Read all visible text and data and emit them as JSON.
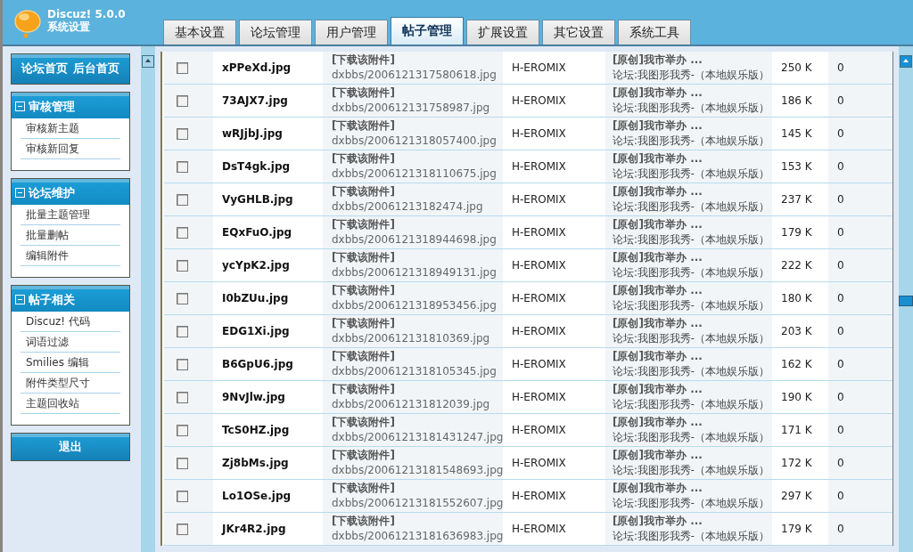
{
  "header": {
    "product": "Discuz! 5.0.0",
    "subtitle": "系统设置"
  },
  "tabs": [
    {
      "label": "基本设置",
      "selected": false
    },
    {
      "label": "论坛管理",
      "selected": false
    },
    {
      "label": "用户管理",
      "selected": false
    },
    {
      "label": "帖子管理",
      "selected": true
    },
    {
      "label": "扩展设置",
      "selected": false
    },
    {
      "label": "其它设置",
      "selected": false
    },
    {
      "label": "系统工具",
      "selected": false
    }
  ],
  "sidebar": {
    "home_links": [
      "论坛首页",
      "后台首页"
    ],
    "groups": [
      {
        "title": "审核管理",
        "expanded": true,
        "items": [
          "审核新主题",
          "审核新回复"
        ]
      },
      {
        "title": "论坛维护",
        "expanded": true,
        "items": [
          "批量主题管理",
          "批量删帖",
          "编辑附件"
        ]
      },
      {
        "title": "帖子相关",
        "expanded": true,
        "items": [
          "Discuz! 代码",
          "词语过滤",
          "Smilies 编辑",
          "附件类型尺寸",
          "主题回收站"
        ]
      }
    ],
    "logout": "退出"
  },
  "table": {
    "rows": [
      {
        "checked": false,
        "filename": "xPPeXd.jpg",
        "link": "[下载该附件]",
        "path": "dxbbs/2006121317580618.jpg",
        "uploader": "H-EROMIX",
        "title": "[原创]我市举办 ...",
        "forum": "论坛:我图形我秀-（本地娱乐版）",
        "size": "250 K",
        "downloads": "0"
      },
      {
        "checked": false,
        "filename": "73AJX7.jpg",
        "link": "[下载该附件]",
        "path": "dxbbs/200612131758987.jpg",
        "uploader": "H-EROMIX",
        "title": "[原创]我市举办 ...",
        "forum": "论坛:我图形我秀-（本地娱乐版）",
        "size": "186 K",
        "downloads": "0"
      },
      {
        "checked": false,
        "filename": "wRJjbJ.jpg",
        "link": "[下载该附件]",
        "path": "dxbbs/2006121318057400.jpg",
        "uploader": "H-EROMIX",
        "title": "[原创]我市举办 ...",
        "forum": "论坛:我图形我秀-（本地娱乐版）",
        "size": "145 K",
        "downloads": "0"
      },
      {
        "checked": false,
        "filename": "DsT4gk.jpg",
        "link": "[下载该附件]",
        "path": "dxbbs/2006121318110675.jpg",
        "uploader": "H-EROMIX",
        "title": "[原创]我市举办 ...",
        "forum": "论坛:我图形我秀-（本地娱乐版）",
        "size": "153 K",
        "downloads": "0"
      },
      {
        "checked": false,
        "filename": "VyGHLB.jpg",
        "link": "[下载该附件]",
        "path": "dxbbs/20061213182474.jpg",
        "uploader": "H-EROMIX",
        "title": "[原创]我市举办 ...",
        "forum": "论坛:我图形我秀-（本地娱乐版）",
        "size": "237 K",
        "downloads": "0"
      },
      {
        "checked": false,
        "filename": "EQxFuO.jpg",
        "link": "[下载该附件]",
        "path": "dxbbs/2006121318944698.jpg",
        "uploader": "H-EROMIX",
        "title": "[原创]我市举办 ...",
        "forum": "论坛:我图形我秀-（本地娱乐版）",
        "size": "179 K",
        "downloads": "0"
      },
      {
        "checked": false,
        "filename": "ycYpK2.jpg",
        "link": "[下载该附件]",
        "path": "dxbbs/2006121318949131.jpg",
        "uploader": "H-EROMIX",
        "title": "[原创]我市举办 ...",
        "forum": "论坛:我图形我秀-（本地娱乐版）",
        "size": "222 K",
        "downloads": "0"
      },
      {
        "checked": false,
        "filename": "I0bZUu.jpg",
        "link": "[下载该附件]",
        "path": "dxbbs/2006121318953456.jpg",
        "uploader": "H-EROMIX",
        "title": "[原创]我市举办 ...",
        "forum": "论坛:我图形我秀-（本地娱乐版）",
        "size": "180 K",
        "downloads": "0"
      },
      {
        "checked": false,
        "filename": "EDG1Xi.jpg",
        "link": "[下载该附件]",
        "path": "dxbbs/200612131810369.jpg",
        "uploader": "H-EROMIX",
        "title": "[原创]我市举办 ...",
        "forum": "论坛:我图形我秀-（本地娱乐版）",
        "size": "203 K",
        "downloads": "0"
      },
      {
        "checked": false,
        "filename": "B6GpU6.jpg",
        "link": "[下载该附件]",
        "path": "dxbbs/2006121318105345.jpg",
        "uploader": "H-EROMIX",
        "title": "[原创]我市举办 ...",
        "forum": "论坛:我图形我秀-（本地娱乐版）",
        "size": "162 K",
        "downloads": "0"
      },
      {
        "checked": false,
        "filename": "9NvJlw.jpg",
        "link": "[下载该附件]",
        "path": "dxbbs/200612131812039.jpg",
        "uploader": "H-EROMIX",
        "title": "[原创]我市举办 ...",
        "forum": "论坛:我图形我秀-（本地娱乐版）",
        "size": "190 K",
        "downloads": "0"
      },
      {
        "checked": false,
        "filename": "TcS0HZ.jpg",
        "link": "[下载该附件]",
        "path": "dxbbs/20061213181431247.jpg",
        "uploader": "H-EROMIX",
        "title": "[原创]我市举办 ...",
        "forum": "论坛:我图形我秀-（本地娱乐版）",
        "size": "171 K",
        "downloads": "0"
      },
      {
        "checked": false,
        "filename": "Zj8bMs.jpg",
        "link": "[下载该附件]",
        "path": "dxbbs/20061213181548693.jpg",
        "uploader": "H-EROMIX",
        "title": "[原创]我市举办 ...",
        "forum": "论坛:我图形我秀-（本地娱乐版）",
        "size": "172 K",
        "downloads": "0"
      },
      {
        "checked": false,
        "filename": "Lo1OSe.jpg",
        "link": "[下载该附件]",
        "path": "dxbbs/20061213181552607.jpg",
        "uploader": "H-EROMIX",
        "title": "[原创]我市举办 ...",
        "forum": "论坛:我图形我秀-（本地娱乐版）",
        "size": "297 K",
        "downloads": "0"
      },
      {
        "checked": false,
        "filename": "JKr4R2.jpg",
        "link": "[下载该附件]",
        "path": "dxbbs/20061213181636983.jpg",
        "uploader": "H-EROMIX",
        "title": "[原创]我市举办 ...",
        "forum": "论坛:我图形我秀-（本地娱乐版）",
        "size": "179 K",
        "downloads": "0"
      }
    ]
  }
}
